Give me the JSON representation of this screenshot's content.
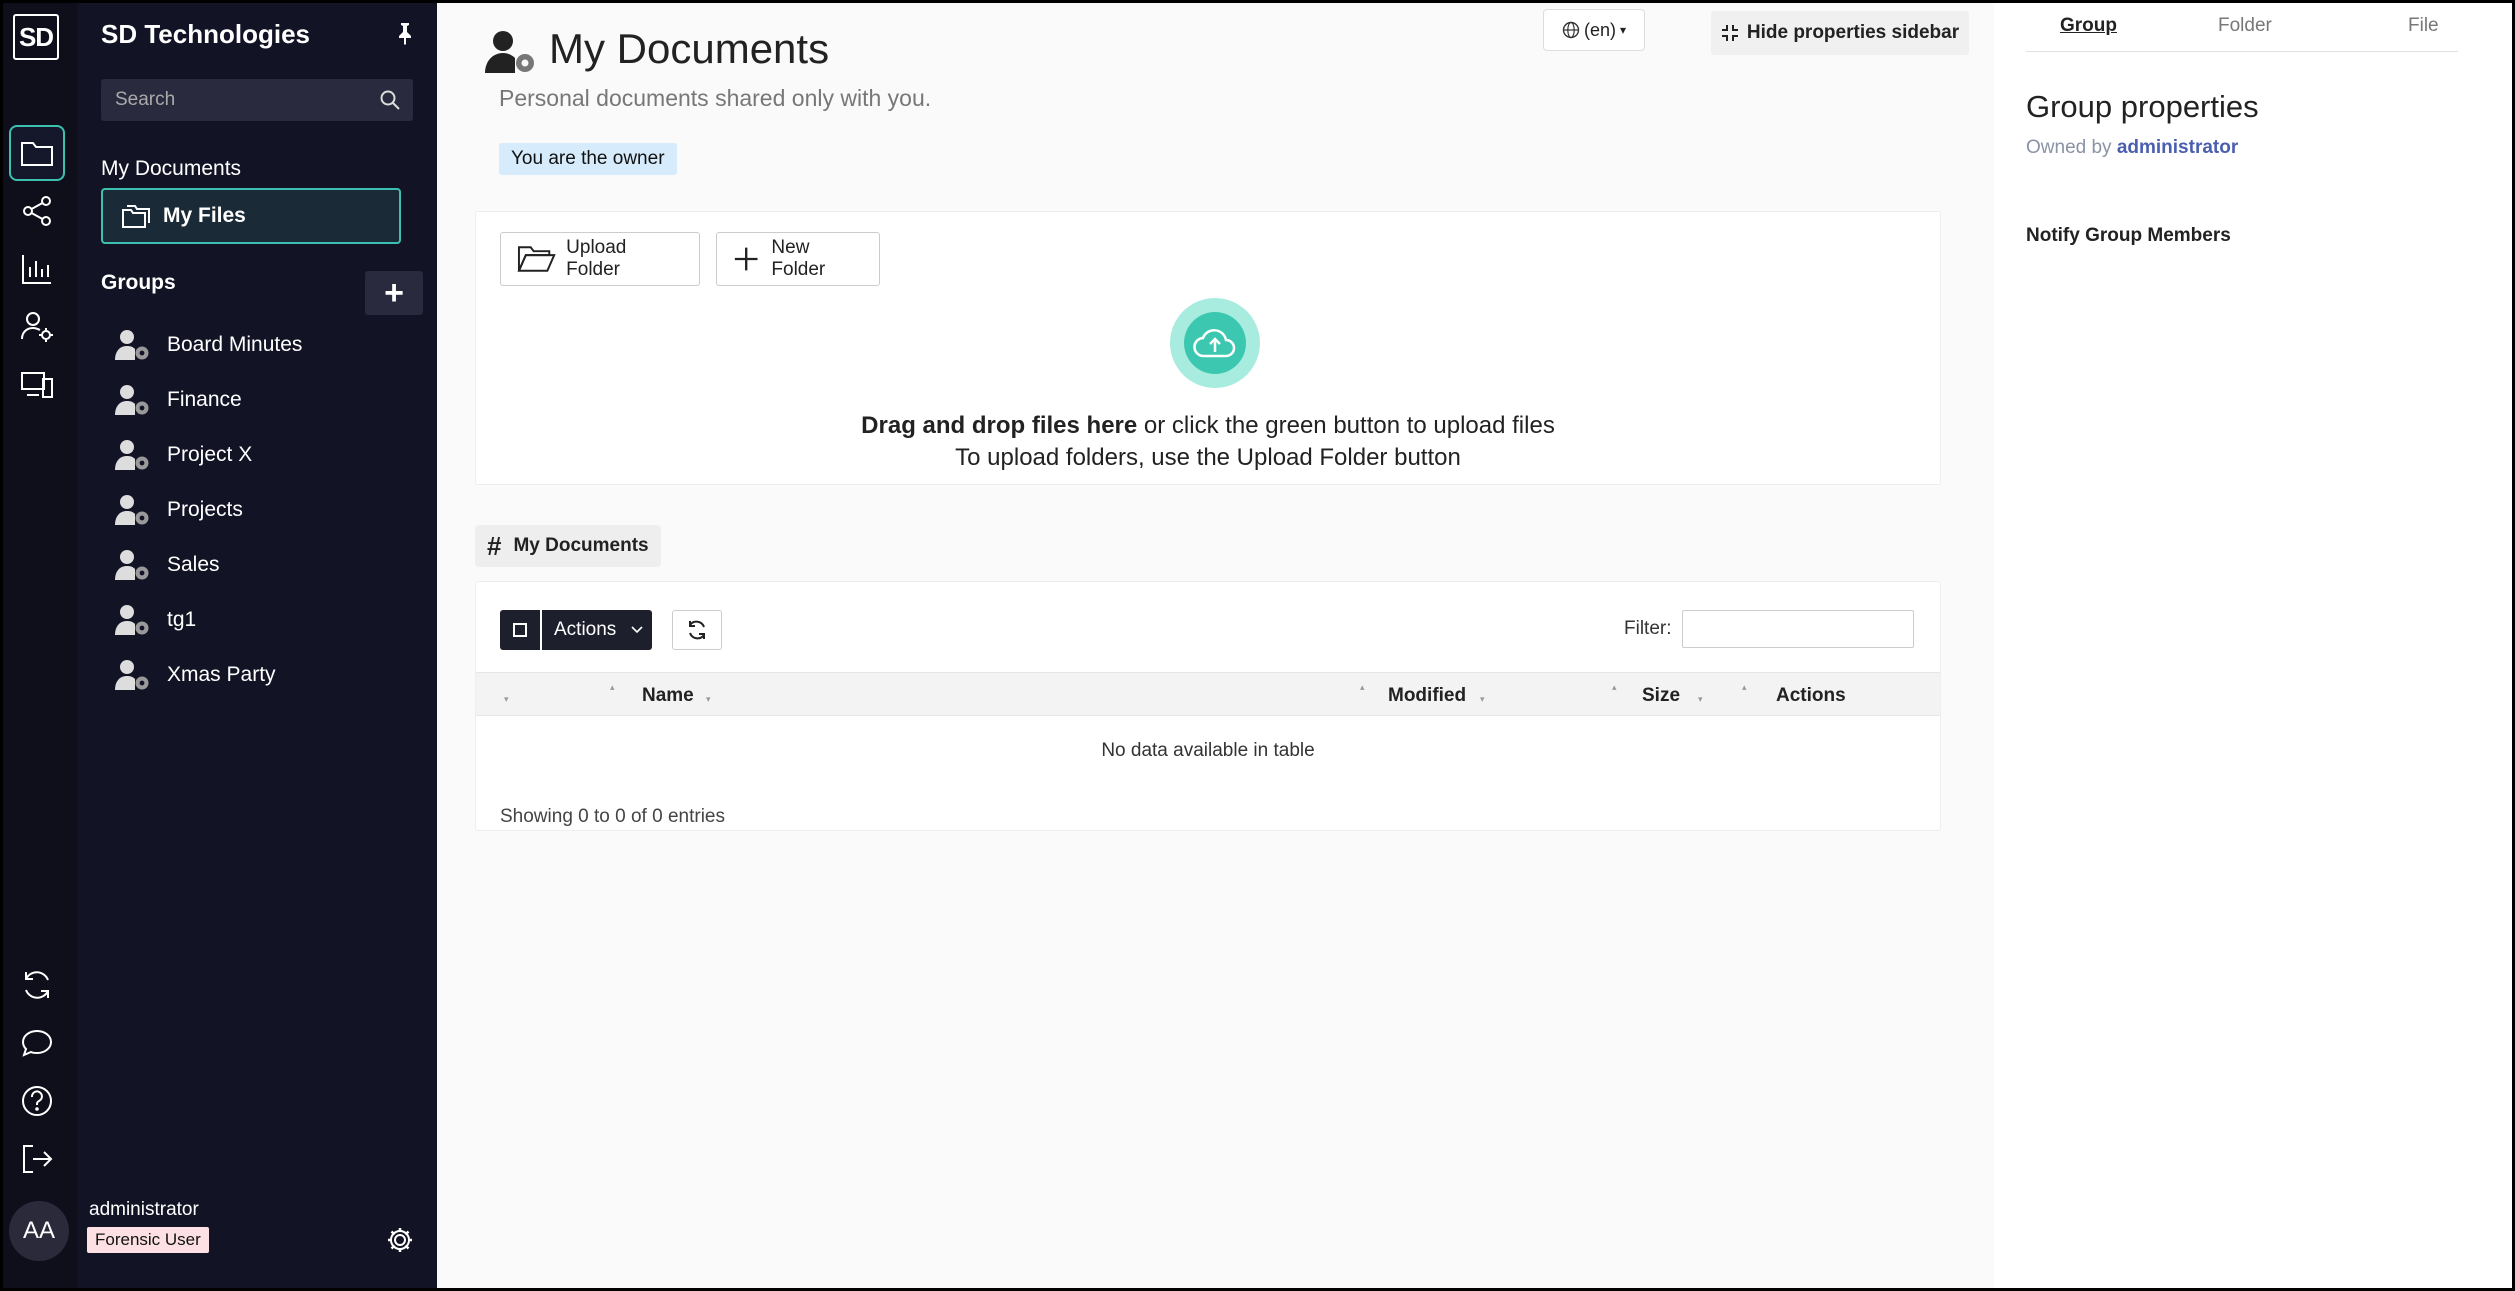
{
  "rail": {
    "logo": "SD",
    "avatar_initials": "AA"
  },
  "nav": {
    "brand": "SD Technologies",
    "search_placeholder": "Search",
    "my_documents": "My Documents",
    "my_files": "My Files",
    "groups_heading": "Groups",
    "add_group": "+",
    "groups": [
      "Board Minutes",
      "Finance",
      "Project X",
      "Projects",
      "Sales",
      "tg1",
      "Xmas Party"
    ],
    "user_name": "administrator",
    "user_role": "Forensic User"
  },
  "header": {
    "title": "My Documents",
    "subtitle": "Personal documents shared only with you.",
    "owner_badge": "You are the owner",
    "language": "(en)",
    "hide_sidebar": "Hide properties sidebar"
  },
  "upload": {
    "upload_folder": "Upload Folder",
    "new_folder": "New Folder",
    "drag_bold": "Drag and drop files here",
    "drag_rest": " or click the green button to upload files",
    "folder_hint": "To upload folders, use the Upload Folder button"
  },
  "table": {
    "breadcrumb": "My Documents",
    "actions_button": "Actions",
    "filter_label": "Filter:",
    "columns": [
      "Name",
      "Modified",
      "Size",
      "Actions"
    ],
    "empty": "No data available in table",
    "info": "Showing 0 to 0 of 0 entries"
  },
  "properties": {
    "tabs": [
      "Group",
      "Folder",
      "File"
    ],
    "active_tab": "Group",
    "title": "Group properties",
    "owned_by_label": "Owned by ",
    "owner": "administrator",
    "notify": "Notify Group Members"
  },
  "colors": {
    "accent": "#3cc0b0",
    "sidebar_bg": "#131326",
    "rail_bg": "#0f0f1c",
    "owner_badge_bg": "#d6ebfb",
    "role_badge_bg": "#fde0e3"
  }
}
